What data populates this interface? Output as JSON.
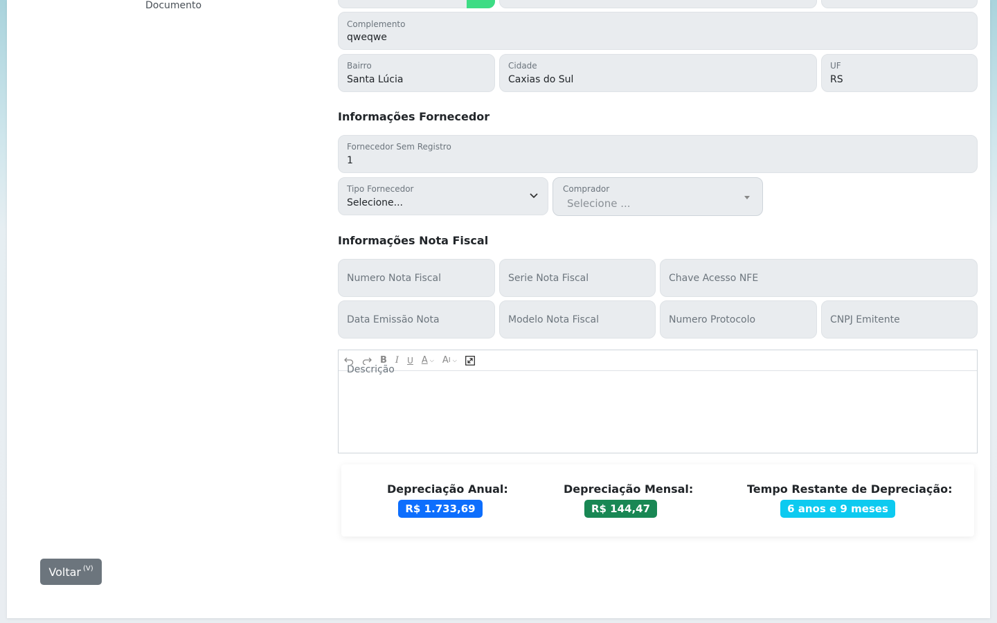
{
  "sidebar": {
    "link_documento": "Documento"
  },
  "endereco": {
    "complemento": {
      "label": "Complemento",
      "value": "qweqwe"
    },
    "bairro": {
      "label": "Bairro",
      "value": "Santa Lúcia"
    },
    "cidade": {
      "label": "Cidade",
      "value": "Caxias do Sul"
    },
    "uf": {
      "label": "UF",
      "value": "RS"
    }
  },
  "fornecedor": {
    "section_title": "Informações Fornecedor",
    "sem_registro": {
      "label": "Fornecedor Sem Registro",
      "value": "1"
    },
    "tipo": {
      "label": "Tipo Fornecedor",
      "value": "Selecione..."
    },
    "comprador": {
      "label": "Comprador",
      "placeholder": "Selecione ..."
    }
  },
  "nota_fiscal": {
    "section_title": "Informações Nota Fiscal",
    "numero": "Numero Nota Fiscal",
    "serie": "Serie Nota Fiscal",
    "chave": "Chave Acesso NFE",
    "data_emissao": "Data Emissão Nota",
    "modelo": "Modelo Nota Fiscal",
    "protocolo": "Numero Protocolo",
    "cnpj": "CNPJ Emitente"
  },
  "editor": {
    "placeholder": "Descrição"
  },
  "depreciacao": {
    "anual_label": "Depreciação Anual:",
    "anual_value": "R$ 1.733,69",
    "mensal_label": "Depreciação Mensal:",
    "mensal_value": "R$ 144,47",
    "tempo_label": "Tempo Restante de Depreciação:",
    "tempo_value": "6 anos e 9 meses",
    "colors": {
      "anual": "#0d6efd",
      "mensal": "#198754",
      "tempo": "#0dcaf0"
    }
  },
  "actions": {
    "back_label": "Voltar",
    "back_shortcut": "(V)"
  }
}
